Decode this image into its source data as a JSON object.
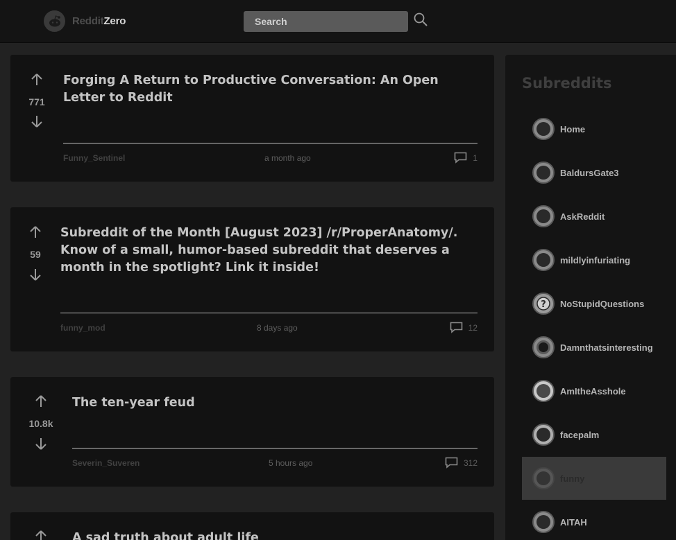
{
  "header": {
    "logo_part1": "Reddit",
    "logo_part2": "Zero",
    "search_placeholder": "Search"
  },
  "posts": [
    {
      "score": "771",
      "title": "Forging A Return to Productive Conversation: An Open Letter to Reddit",
      "author": "Funny_Sentinel",
      "time": "a month ago",
      "comments": "1"
    },
    {
      "score": "59",
      "title": "Subreddit of the Month [August 2023] /r/ProperAnatomy/. Know of a small, humor-based subreddit that deserves a month in the spotlight? Link it inside!",
      "author": "funny_mod",
      "time": "8 days ago",
      "comments": "12"
    },
    {
      "score": "10.8k",
      "title": "The ten-year feud",
      "author": "Severin_Suveren",
      "time": "5 hours ago",
      "comments": "312"
    },
    {
      "score": "",
      "title": "A sad truth about adult life",
      "author": "",
      "time": "",
      "comments": ""
    }
  ],
  "sidebar": {
    "title": "Subreddits",
    "selected": "funny",
    "items": [
      {
        "label": "Home",
        "icon": "subreddit-avatar-icon"
      },
      {
        "label": "BaldursGate3",
        "icon": "subreddit-avatar-icon"
      },
      {
        "label": "AskReddit",
        "icon": "subreddit-avatar-icon"
      },
      {
        "label": "mildlyinfuriating",
        "icon": "subreddit-avatar-icon"
      },
      {
        "label": "NoStupidQuestions",
        "icon": "question-mark-icon"
      },
      {
        "label": "Damnthatsinteresting",
        "icon": "subreddit-avatar-icon"
      },
      {
        "label": "AmItheAsshole",
        "icon": "subreddit-avatar-icon"
      },
      {
        "label": "facepalm",
        "icon": "subreddit-avatar-icon"
      },
      {
        "label": "funny",
        "icon": "subreddit-avatar-icon"
      },
      {
        "label": "AITAH",
        "icon": "subreddit-avatar-icon"
      }
    ]
  },
  "colors": {
    "page_bg": "#222222",
    "card_bg": "#121212",
    "header_bg": "#141414",
    "selected_bg": "#3a3a3a"
  }
}
